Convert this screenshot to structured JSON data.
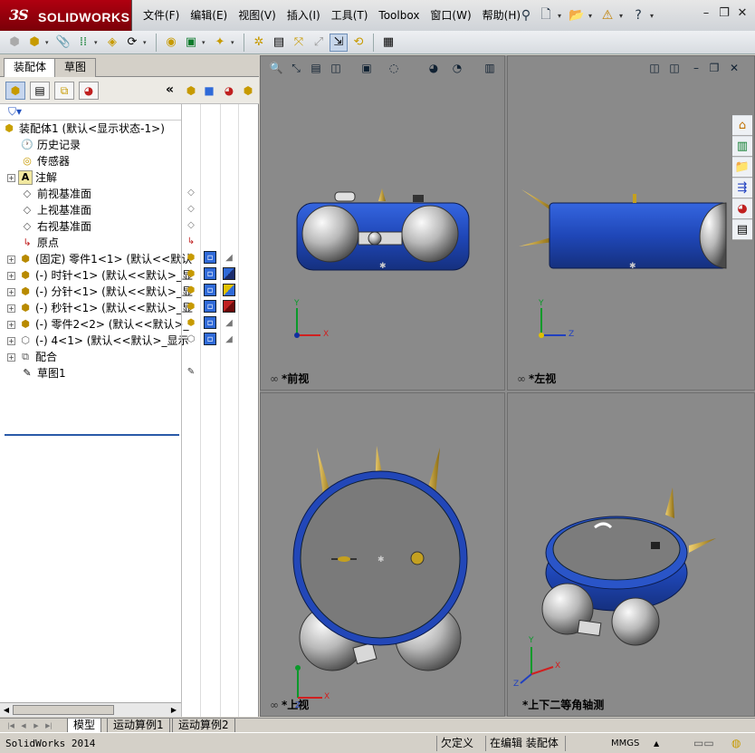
{
  "app": {
    "logo_ds": "3S",
    "logo_name": "SOLIDWORKS"
  },
  "menu": [
    "文件(F)",
    "编辑(E)",
    "视图(V)",
    "插入(I)",
    "工具(T)",
    "Toolbox",
    "窗口(W)",
    "帮助(H)"
  ],
  "left_panel": {
    "tabs": [
      "装配体",
      "草图"
    ],
    "collapse_glyph": "«",
    "tree": [
      {
        "label": "装配体1  (默认<显示状态-1>)",
        "icon": "assembly-icon",
        "glyph": "⬢"
      },
      {
        "label": "历史记录",
        "icon": "history-icon",
        "glyph": "🕐"
      },
      {
        "label": "传感器",
        "icon": "sensor-icon",
        "glyph": "◎"
      },
      {
        "label": "注解",
        "icon": "annotation-icon",
        "glyph": "A"
      },
      {
        "label": "前视基准面",
        "icon": "plane-icon",
        "glyph": "◇"
      },
      {
        "label": "上视基准面",
        "icon": "plane-icon",
        "glyph": "◇"
      },
      {
        "label": "右视基准面",
        "icon": "plane-icon",
        "glyph": "◇"
      },
      {
        "label": "原点",
        "icon": "origin-icon",
        "glyph": "↳"
      },
      {
        "label": "(固定) 零件1<1> (默认<<默认",
        "icon": "part-icon",
        "glyph": "⬢"
      },
      {
        "label": "(-) 时针<1> (默认<<默认>_显",
        "icon": "part-icon",
        "glyph": "⬢"
      },
      {
        "label": "(-) 分针<1> (默认<<默认>_显",
        "icon": "part-icon",
        "glyph": "⬢"
      },
      {
        "label": "(-) 秒针<1> (默认<<默认>_显",
        "icon": "part-icon",
        "glyph": "⬢"
      },
      {
        "label": "(-) 零件2<2> (默认<<默认>_",
        "icon": "part-icon",
        "glyph": "⬢"
      },
      {
        "label": "(-) 4<1> (默认<<默认>_显示",
        "icon": "part-outline-icon",
        "glyph": "⬡"
      },
      {
        "label": "配合",
        "icon": "mates-icon",
        "glyph": "⧉"
      },
      {
        "label": "草图1",
        "icon": "sketch-icon",
        "glyph": "✎"
      }
    ]
  },
  "viewport": {
    "views": [
      {
        "name": "*前视",
        "link": "∞"
      },
      {
        "name": "*左视",
        "link": "∞"
      },
      {
        "name": "*上视",
        "link": "∞"
      },
      {
        "name": "*上下二等角轴测",
        "link": ""
      }
    ],
    "axis": {
      "x": "X",
      "y": "Y",
      "z": "Z"
    }
  },
  "bottom_tabs": [
    "模型",
    "运动算例1",
    "运动算例2"
  ],
  "status": {
    "app_name": "SolidWorks 2014",
    "state": "欠定义",
    "mode": "在编辑 装配体",
    "units": "MMGS",
    "units_arrow": "▲"
  }
}
